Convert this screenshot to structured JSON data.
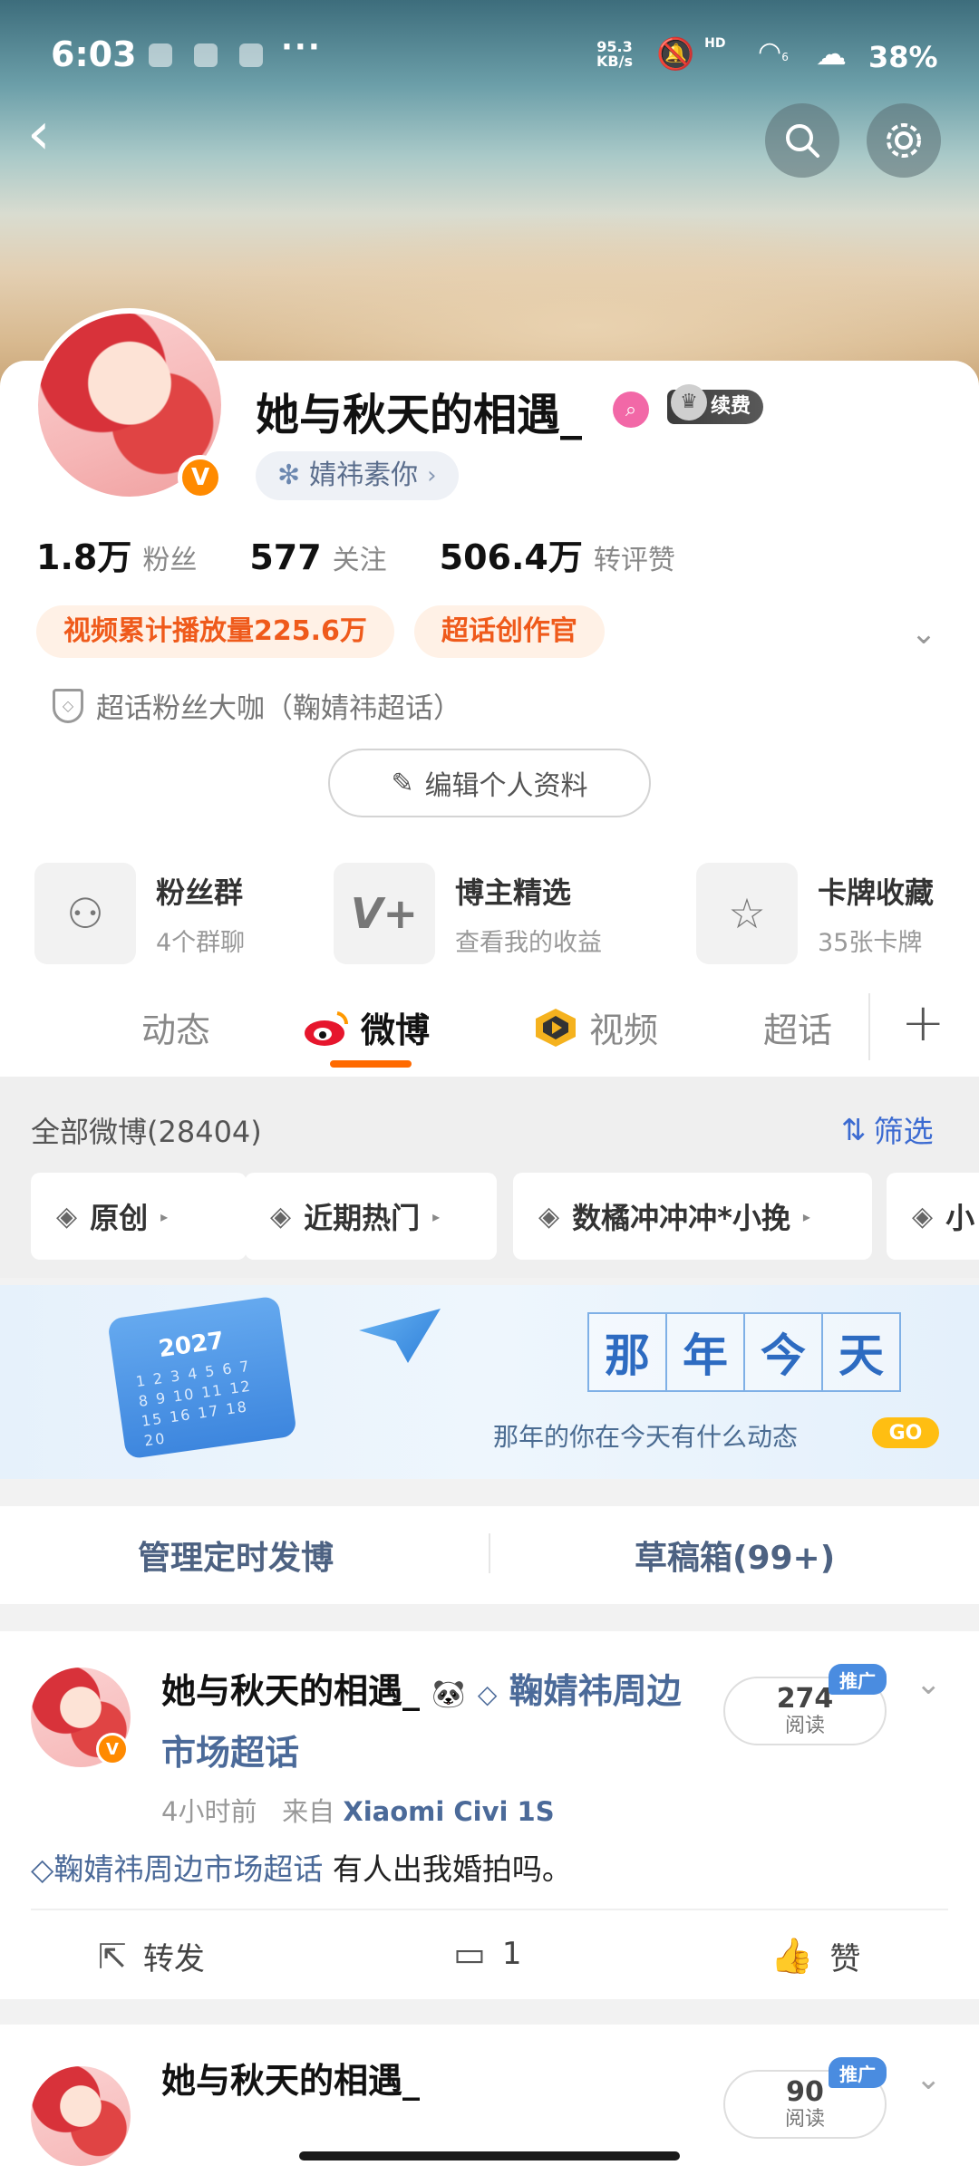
{
  "status_bar": {
    "time": "6:03",
    "net_speed_value": "95.3",
    "net_speed_unit": "KB/s",
    "network_label": "HD",
    "wifi_sub": "6",
    "battery": "38%"
  },
  "profile": {
    "name": "她与秋天的相遇_",
    "renew_label": "续费",
    "super_topic": "婧祎素你",
    "stats": [
      {
        "value": "1.8万",
        "label": "粉丝"
      },
      {
        "value": "577",
        "label": "关注"
      },
      {
        "value": "506.4万",
        "label": "转评赞"
      }
    ],
    "tags": [
      "视频累计播放量225.6万",
      "超话创作官"
    ],
    "fan_title": "超话粉丝大咖（鞠婧祎超话）",
    "edit_button": "编辑个人资料"
  },
  "features": [
    {
      "title": "粉丝群",
      "sub": "4个群聊",
      "icon": "people-icon"
    },
    {
      "title": "博主精选",
      "sub": "查看我的收益",
      "icon": "v-plus-icon"
    },
    {
      "title": "卡牌收藏",
      "sub": "35张卡牌",
      "icon": "card-icon"
    }
  ],
  "tabs": [
    {
      "label": "动态",
      "active": false
    },
    {
      "label": "微博",
      "active": true
    },
    {
      "label": "视频",
      "active": false
    },
    {
      "label": "超话",
      "active": false
    }
  ],
  "feed_filter": {
    "all_label": "全部微博(28404)",
    "filter_button": "筛选",
    "chips": [
      "原创",
      "近期热门",
      "数橘冲冲冲*小挽",
      "小"
    ]
  },
  "banner": {
    "calendar_year": "2027",
    "title_chars": [
      "那",
      "年",
      "今",
      "天"
    ],
    "subtitle": "那年的你在今天有什么动态",
    "go": "GO"
  },
  "manage": {
    "scheduled": "管理定时发博",
    "drafts": "草稿箱(99+)"
  },
  "posts": [
    {
      "author": "她与秋天的相遇_",
      "author_topic": "鞠婧祎周边市场超话",
      "time": "4小时前",
      "source_prefix": "来自",
      "source": "Xiaomi Civi 1S",
      "topic": "鞠婧祎周边市场超话",
      "text": "有人出我婚拍吗。",
      "reads": "274",
      "reads_label": "阅读",
      "promo": "推广",
      "repost": "转发",
      "comments": "1",
      "like": "赞"
    },
    {
      "author": "她与秋天的相遇_",
      "reads": "90",
      "reads_label": "阅读",
      "promo": "推广"
    }
  ]
}
